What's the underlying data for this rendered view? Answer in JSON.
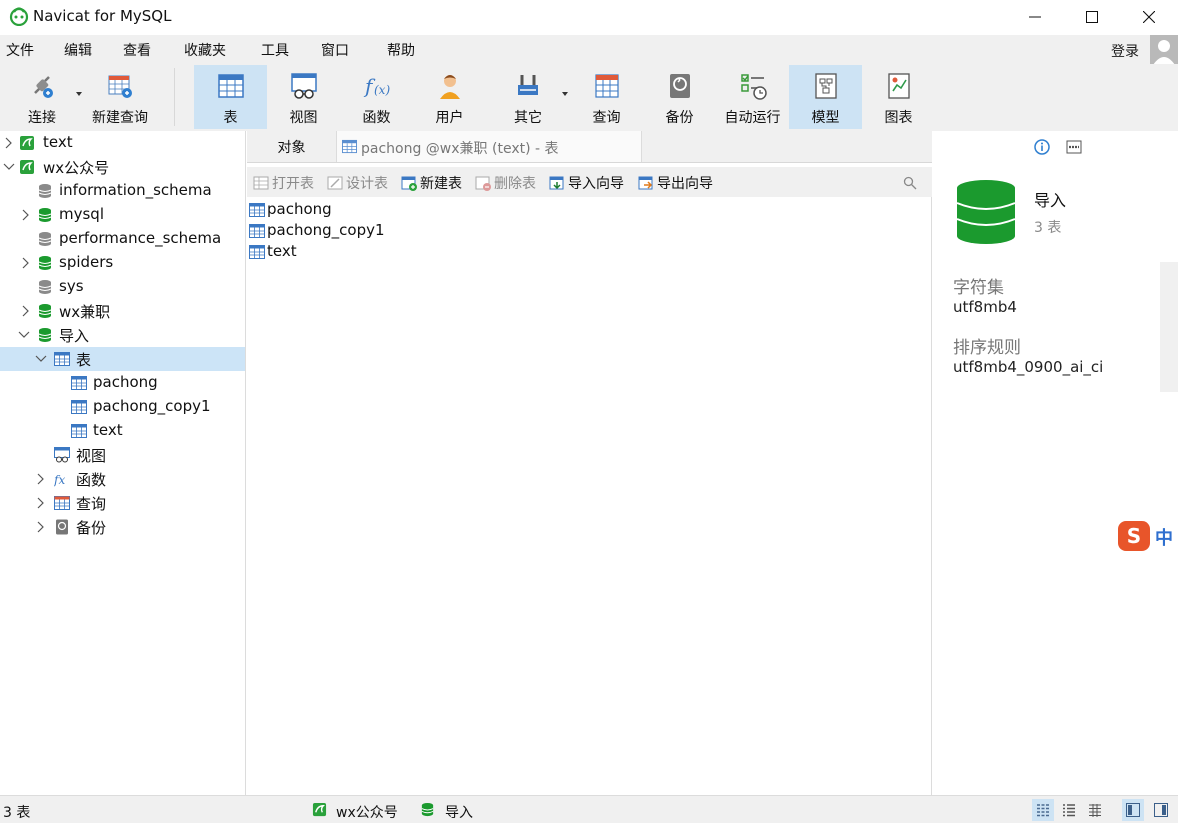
{
  "window": {
    "title": "Navicat for MySQL"
  },
  "menu": [
    "文件",
    "编辑",
    "查看",
    "收藏夹",
    "工具",
    "窗口",
    "帮助"
  ],
  "account": {
    "login_label": "登录"
  },
  "toolbar": {
    "connect": "连接",
    "new_query": "新建查询",
    "table": "表",
    "view": "视图",
    "function": "函数",
    "user": "用户",
    "other": "其它",
    "query": "查询",
    "backup": "备份",
    "automation": "自动运行",
    "model": "模型",
    "chart": "图表"
  },
  "tree": {
    "conn_text": "text",
    "conn_wx": "wx公众号",
    "db_information_schema": "information_schema",
    "db_mysql": "mysql",
    "db_performance_schema": "performance_schema",
    "db_spiders": "spiders",
    "db_sys": "sys",
    "db_wx_jianzhi": "wx兼职",
    "db_import": "导入",
    "node_tables": "表",
    "table_pachong": "pachong",
    "table_pachong_copy1": "pachong_copy1",
    "table_text": "text",
    "node_views": "视图",
    "node_functions": "函数",
    "node_queries": "查询",
    "node_backups": "备份"
  },
  "tabs": {
    "objects": "对象",
    "table_tab": "pachong @wx兼职 (text) - 表"
  },
  "object_toolbar": {
    "open_table": "打开表",
    "design_table": "设计表",
    "new_table": "新建表",
    "delete_table": "删除表",
    "import_wizard": "导入向导",
    "export_wizard": "导出向导"
  },
  "objects": [
    "pachong",
    "pachong_copy1",
    "text"
  ],
  "info": {
    "db_name": "导入",
    "table_count": "3 表",
    "charset_label": "字符集",
    "charset_value": "utf8mb4",
    "collation_label": "排序规则",
    "collation_value": "utf8mb4_0900_ai_ci"
  },
  "ime": {
    "label": "中"
  },
  "status": {
    "count": "3 表",
    "connection": "wx公众号",
    "database": "导入"
  },
  "colors": {
    "selection": "#cce4f7",
    "toolbar_active": "#cde3f4",
    "db_green": "#1b9a2e",
    "chrome_gray": "#f0f0f0"
  }
}
